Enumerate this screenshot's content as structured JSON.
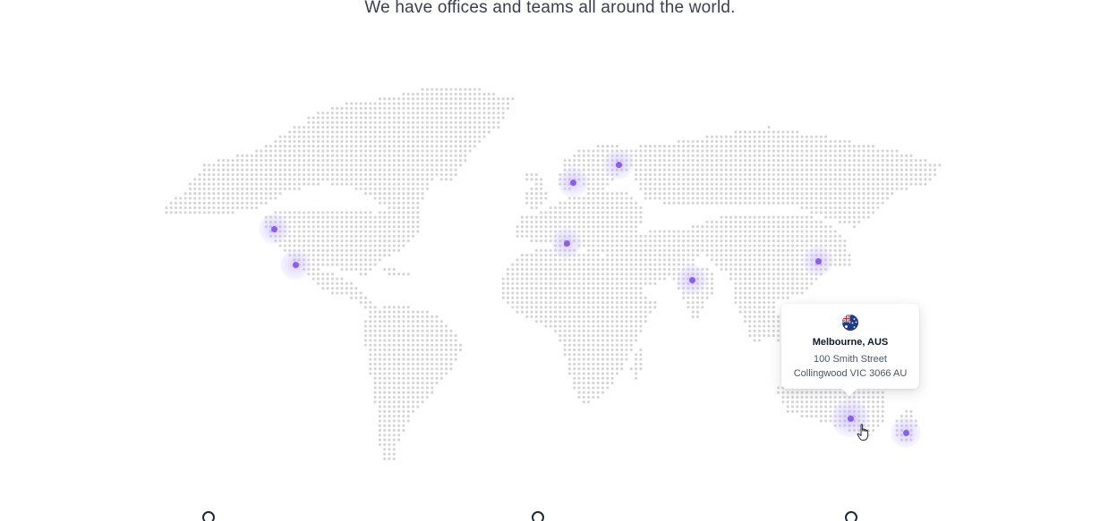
{
  "page": {
    "subtitle": "We have offices and teams all around the world."
  },
  "theme": {
    "map_dot_color": "#d4d4d4",
    "marker_color": "#8b5cf6",
    "marker_halo_color": "#c4b5fd"
  },
  "offices": [
    {
      "id": "west-coast-north",
      "active": false
    },
    {
      "id": "west-coast-south",
      "active": false
    },
    {
      "id": "northern-europe",
      "active": false
    },
    {
      "id": "scandinavia",
      "active": false
    },
    {
      "id": "southern-europe",
      "active": false
    },
    {
      "id": "india",
      "active": false
    },
    {
      "id": "east-asia",
      "active": false
    },
    {
      "id": "melbourne",
      "active": true
    },
    {
      "id": "new-zealand",
      "active": false
    }
  ],
  "tooltip": {
    "flag_icon": "australia-flag-icon",
    "city": "Melbourne, AUS",
    "address_line1": "100 Smith Street",
    "address_line2": "Collingwood VIC 3066 AU"
  },
  "cursor_icon": "hand-pointer-icon"
}
